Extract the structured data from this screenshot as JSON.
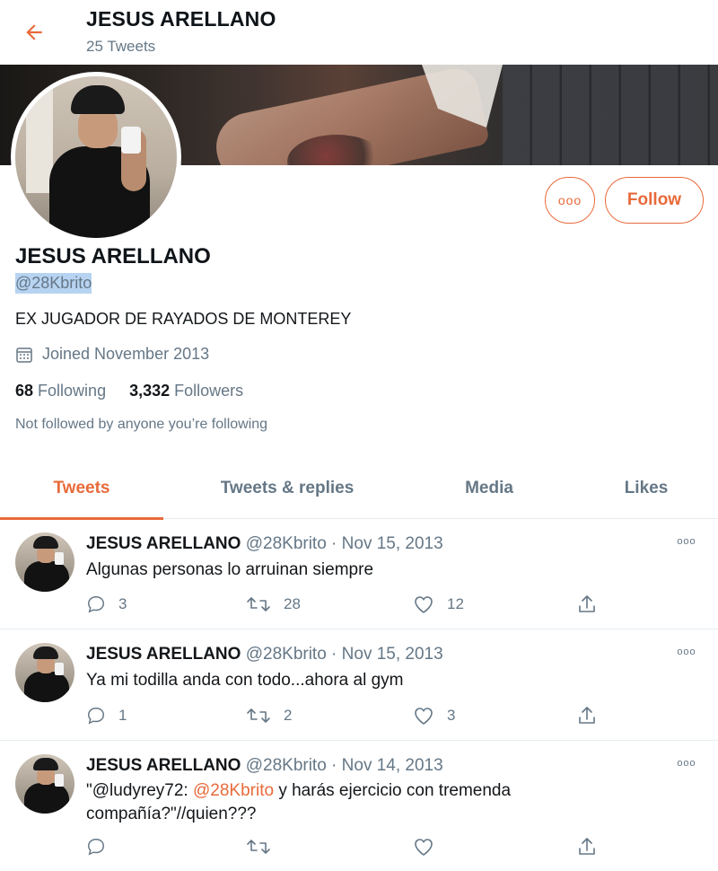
{
  "header": {
    "title": "JESUS ARELLANO",
    "tweet_count": "25 Tweets"
  },
  "profile": {
    "name": "JESUS ARELLANO",
    "handle": "@28Kbrito",
    "bio": "EX JUGADOR DE RAYADOS DE MONTEREY",
    "joined": "Joined November 2013",
    "following_count": "68",
    "following_label": "Following",
    "followers_count": "3,332",
    "followers_label": "Followers",
    "not_followed": "Not followed by anyone you’re following",
    "more_label": "ooo",
    "follow_label": "Follow"
  },
  "tabs": [
    {
      "label": "Tweets",
      "active": true
    },
    {
      "label": "Tweets & replies",
      "active": false
    },
    {
      "label": "Media",
      "active": false
    },
    {
      "label": "Likes",
      "active": false
    }
  ],
  "tweets": [
    {
      "name": "JESUS ARELLANO",
      "meta": "@28Kbrito · Nov 15, 2013",
      "text": "Algunas personas lo arruinan siempre",
      "replies": "3",
      "retweets": "28",
      "likes": "12"
    },
    {
      "name": "JESUS ARELLANO",
      "meta": "@28Kbrito · Nov 15, 2013",
      "text": "Ya mi todilla anda con todo...ahora al gym",
      "replies": "1",
      "retweets": "2",
      "likes": "3"
    },
    {
      "name": "JESUS ARELLANO",
      "meta": "@28Kbrito · Nov 14, 2013",
      "text_pre": "\"@ludyrey72: ",
      "text_mention": "@28Kbrito",
      "text_post": " y harás ejercicio con tremenda compañía?\"//quien???",
      "replies": "",
      "retweets": "",
      "likes": ""
    }
  ],
  "tweet_more_label": "ooo",
  "icons": {
    "back": "arrow-left-icon",
    "calendar": "calendar-icon",
    "reply": "reply-icon",
    "retweet": "retweet-icon",
    "like": "heart-icon",
    "share": "share-icon"
  },
  "colors": {
    "accent": "#e86a3a",
    "secondary_text": "#657786",
    "handle_highlight": "#b7d3f2"
  }
}
